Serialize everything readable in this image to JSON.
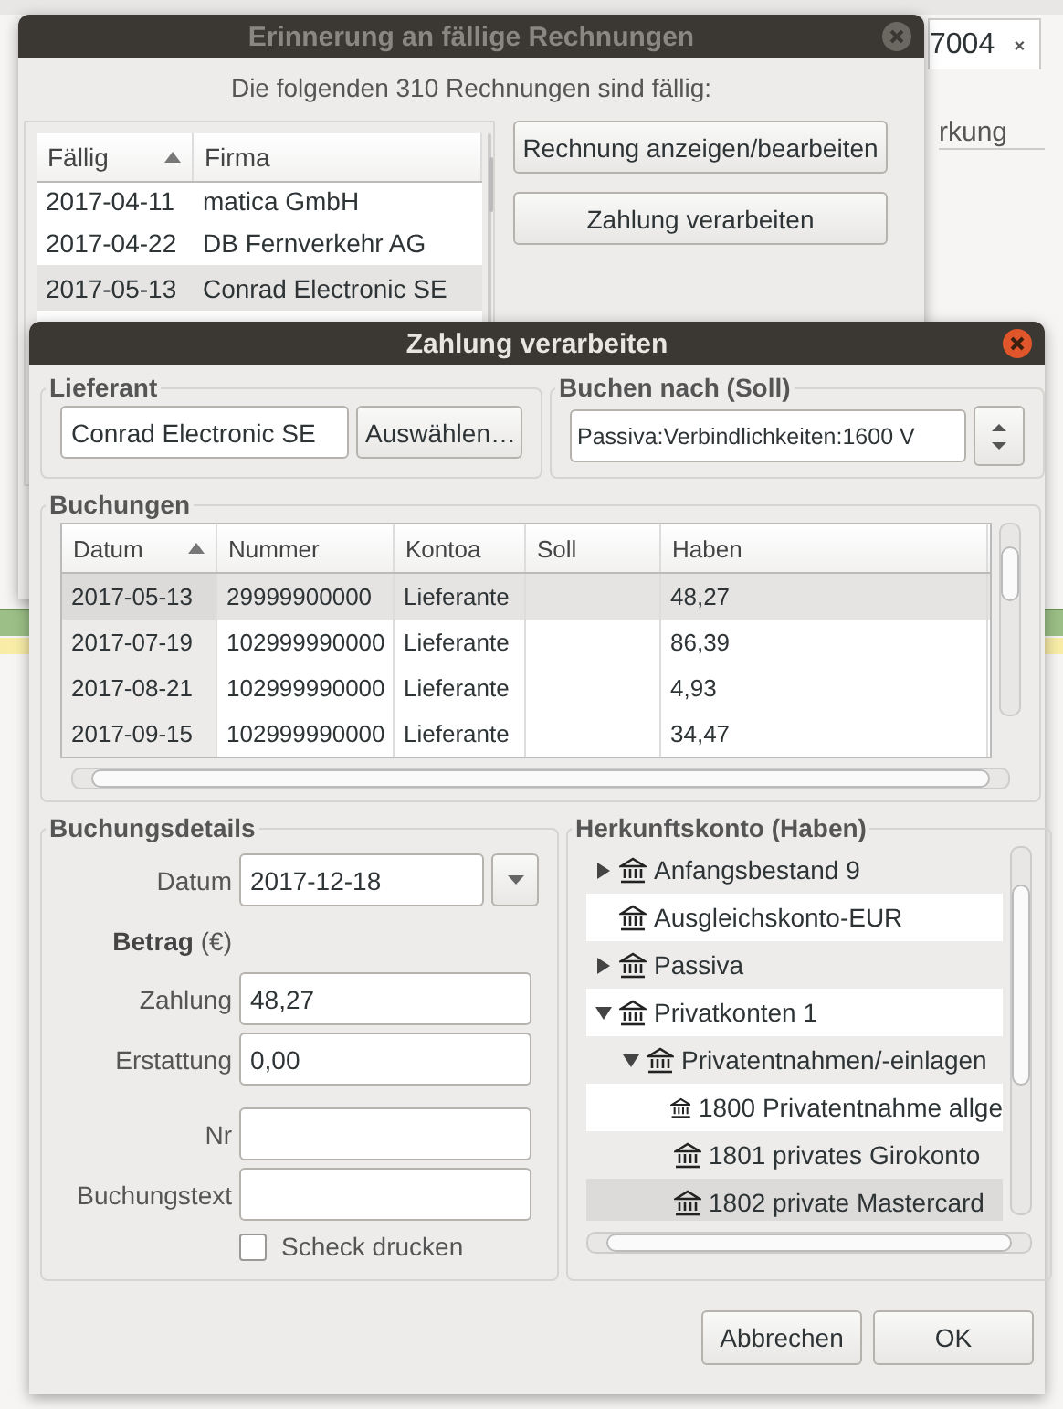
{
  "background": {
    "tab": {
      "label": "7004"
    },
    "frame_label": "rkung"
  },
  "reminder_dialog": {
    "title": "Erinnerung an fällige Rechnungen",
    "message": "Die folgenden 310 Rechnungen sind fällig:",
    "columns": [
      "Fällig",
      "Firma"
    ],
    "rows": [
      {
        "cells": [
          "2017-04-11",
          "matica GmbH"
        ],
        "selected": false
      },
      {
        "cells": [
          "2017-04-22",
          "DB Fernverkehr AG"
        ],
        "selected": false
      },
      {
        "cells": [
          "2017-05-13",
          "Conrad Electronic SE"
        ],
        "selected": true
      }
    ],
    "buttons": [
      "Rechnung anzeigen/bearbeiten",
      "Zahlung verarbeiten"
    ]
  },
  "payment_dialog": {
    "title": "Zahlung verarbeiten",
    "supplier": {
      "label": "Lieferant",
      "value": "Conrad Electronic SE",
      "button": "Auswählen…"
    },
    "post_to": {
      "label": "Buchen nach (Soll)",
      "value": "Passiva:Verbindlichkeiten:1600 V"
    },
    "postings": {
      "label": "Buchungen",
      "columns": [
        "Datum",
        "Nummer",
        "Kontoa",
        "Soll",
        "Haben"
      ],
      "rows": [
        {
          "cells": [
            "2017-05-13",
            "29999900000",
            "Lieferante",
            "",
            "48,27"
          ],
          "selected": true
        },
        {
          "cells": [
            "2017-07-19",
            "102999990000",
            "Lieferante",
            "",
            "86,39"
          ],
          "selected": false
        },
        {
          "cells": [
            "2017-08-21",
            "102999990000",
            "Lieferante",
            "",
            "4,93"
          ],
          "selected": false
        },
        {
          "cells": [
            "2017-09-15",
            "102999990000",
            "Lieferante",
            "",
            "34,47"
          ],
          "selected": false
        }
      ]
    },
    "details": {
      "label": "Buchungsdetails",
      "date_label": "Datum",
      "date": "2017-12-18",
      "amount_label": "Betrag",
      "amount_unit": "(€)",
      "payment_label": "Zahlung",
      "payment": "48,27",
      "refund_label": "Erstattung",
      "refund": "0,00",
      "number_label": "Nr",
      "text_label": "Buchungstext",
      "print_check": {
        "label": "Scheck drucken",
        "checked": false
      }
    },
    "source_account": {
      "label": "Herkunftskonto (Haben)",
      "tree": [
        {
          "label": "Anfangsbestand 9",
          "expandable": true,
          "expanded": false,
          "selected": false
        },
        {
          "label": "Ausgleichskonto-EUR",
          "expandable": false,
          "selected": false
        },
        {
          "label": "Passiva",
          "expandable": true,
          "expanded": false,
          "selected": false
        },
        {
          "label": "Privatkonten 1",
          "expandable": true,
          "expanded": true,
          "selected": false,
          "children": [
            {
              "label": "Privatentnahmen/-einlagen",
              "expandable": true,
              "expanded": true,
              "selected": false,
              "children": [
                {
                  "label": "1800 Privatentnahme allge",
                  "expandable": false,
                  "selected": false
                },
                {
                  "label": "1801 privates Girokonto",
                  "expandable": false,
                  "selected": false
                },
                {
                  "label": "1802 private Mastercard",
                  "expandable": false,
                  "selected": true
                }
              ]
            }
          ]
        }
      ]
    },
    "buttons": [
      "Abbrechen",
      "OK"
    ]
  }
}
